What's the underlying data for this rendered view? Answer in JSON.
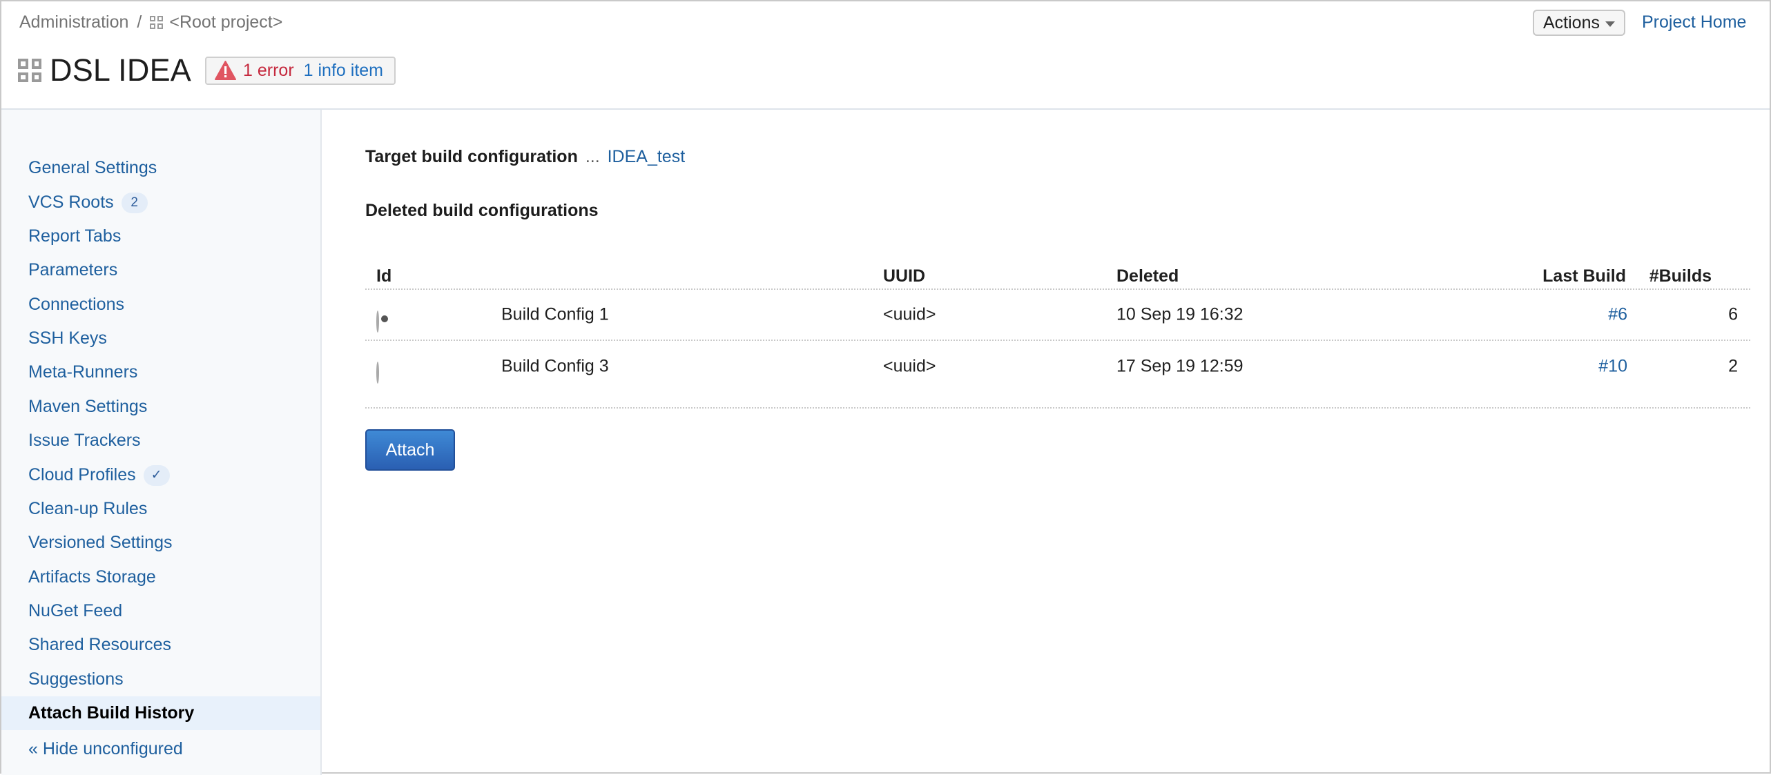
{
  "header": {
    "breadcrumb": [
      {
        "label": "Administration"
      },
      {
        "separator": "/"
      },
      {
        "label": "<Root project>",
        "icon": "project-grid-icon"
      }
    ],
    "title": "DSL IDEA",
    "title_icon": "project-grid-icon",
    "status_badge": {
      "icon": "warning-triangle-icon",
      "error_text": "1 error",
      "info_text": "1 info item",
      "error_color": "#c5283d",
      "info_color": "#1e6fbf"
    },
    "actions_label": "Actions",
    "project_home_label": "Project Home"
  },
  "sidebar": {
    "items": [
      {
        "label": "General Settings"
      },
      {
        "label": "VCS Roots",
        "badge": "2"
      },
      {
        "label": "Report Tabs"
      },
      {
        "label": "Parameters"
      },
      {
        "label": "Connections"
      },
      {
        "label": "SSH Keys"
      },
      {
        "label": "Meta-Runners"
      },
      {
        "label": "Maven Settings"
      },
      {
        "label": "Issue Trackers"
      },
      {
        "label": "Cloud Profiles",
        "badge": "✓"
      },
      {
        "label": "Clean-up Rules"
      },
      {
        "label": "Versioned Settings"
      },
      {
        "label": "Artifacts Storage"
      },
      {
        "label": "NuGet Feed"
      },
      {
        "label": "Shared Resources"
      },
      {
        "label": "Suggestions"
      },
      {
        "label": "Attach Build History",
        "active": true
      }
    ],
    "hide_unconfigured_label": "« Hide unconfigured"
  },
  "main": {
    "target_label": "Target build configuration",
    "target_separator": "...",
    "target_value": "IDEA_test",
    "section_title": "Deleted build configurations",
    "table": {
      "columns": [
        "Id",
        "UUID",
        "Deleted",
        "Last Build",
        "#Builds"
      ],
      "rows": [
        {
          "selected": true,
          "name": "Build Config 1",
          "uuid": "<uuid>",
          "deleted": "10 Sep 19 16:32",
          "last_build": "#6",
          "builds": "6"
        },
        {
          "selected": false,
          "name": "Build Config 3",
          "uuid": "<uuid>",
          "deleted": "17 Sep 19 12:59",
          "last_build": "#10",
          "builds": "2"
        }
      ]
    },
    "attach_label": "Attach"
  },
  "colors": {
    "link": "#1e5f9e",
    "active_nav_bg": "#e8f1fb",
    "sidebar_bg": "#f7f9fb",
    "primary_button": "#2f6cc0"
  }
}
